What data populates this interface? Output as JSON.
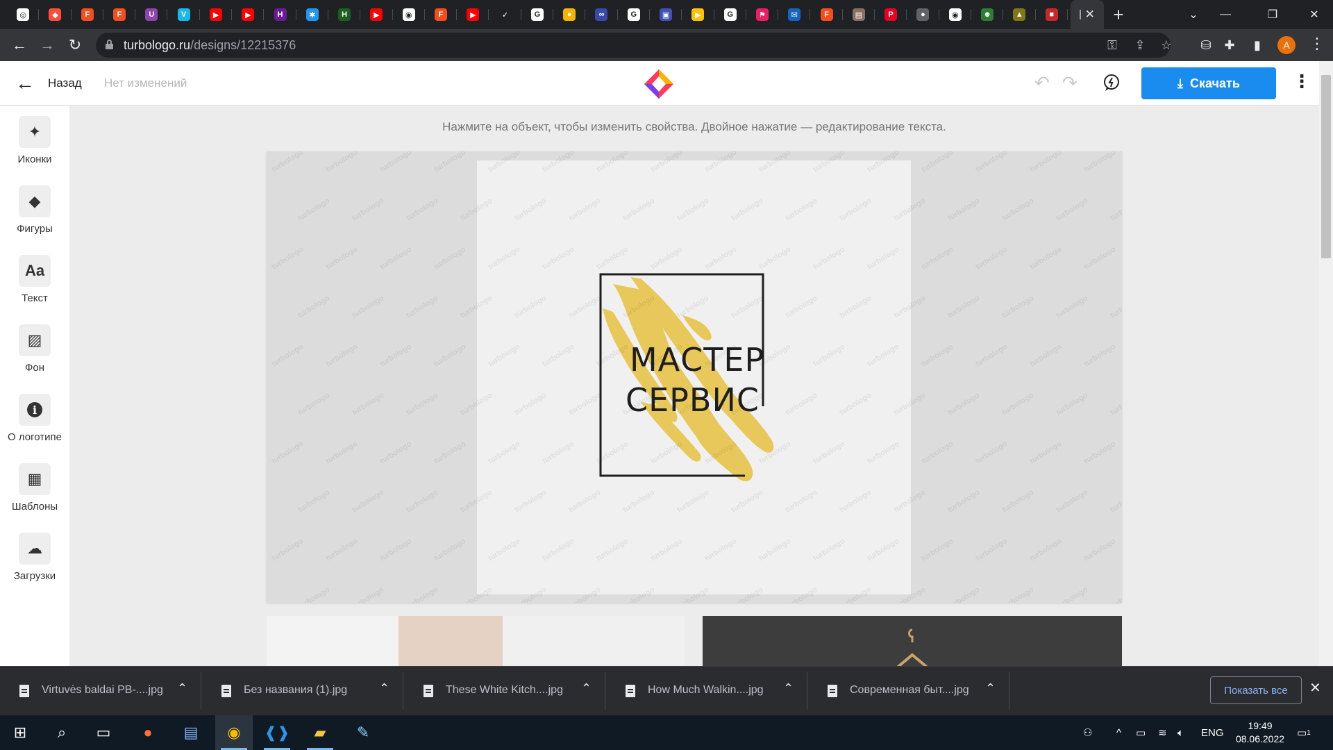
{
  "browser": {
    "tab_favicons": [
      {
        "icon": "chatgpt-like-icon",
        "color": "#ffffff",
        "glyph": "◎"
      },
      {
        "icon": "turbologo-icon",
        "color": "#ff4d3d",
        "glyph": "◆"
      },
      {
        "icon": "figma-icon",
        "color": "#f24e1e",
        "glyph": "F"
      },
      {
        "icon": "figma-icon",
        "color": "#f24e1e",
        "glyph": "F"
      },
      {
        "icon": "u-icon",
        "color": "#8e44ad",
        "glyph": "U"
      },
      {
        "icon": "vimeo-icon",
        "color": "#1ab7ea",
        "glyph": "V"
      },
      {
        "icon": "youtube-icon",
        "color": "#ff0000",
        "glyph": "▶"
      },
      {
        "icon": "youtube-icon",
        "color": "#ff0000",
        "glyph": "▶"
      },
      {
        "icon": "h-icon",
        "color": "#6a1b9a",
        "glyph": "H"
      },
      {
        "icon": "snowflake-icon",
        "color": "#2196f3",
        "glyph": "✱"
      },
      {
        "icon": "h-icon",
        "color": "#1b5e20",
        "glyph": "H"
      },
      {
        "icon": "youtube-icon",
        "color": "#ff0000",
        "glyph": "▶"
      },
      {
        "icon": "globe-icon",
        "color": "#ffffff",
        "glyph": "◉"
      },
      {
        "icon": "figma-icon",
        "color": "#f24e1e",
        "glyph": "F"
      },
      {
        "icon": "youtube-icon",
        "color": "#ff0000",
        "glyph": "▶"
      },
      {
        "icon": "nike-icon",
        "color": "#202124",
        "glyph": "✓"
      },
      {
        "icon": "google-icon",
        "color": "#ffffff",
        "glyph": "G"
      },
      {
        "icon": "circle-icon",
        "color": "#f4b400",
        "glyph": "●"
      },
      {
        "icon": "link-icon",
        "color": "#3949ab",
        "glyph": "∞"
      },
      {
        "icon": "google-icon",
        "color": "#ffffff",
        "glyph": "G"
      },
      {
        "icon": "app-icon",
        "color": "#3f51b5",
        "glyph": "▣"
      },
      {
        "icon": "play-icon",
        "color": "#ffc107",
        "glyph": "▶"
      },
      {
        "icon": "google-icon",
        "color": "#ffffff",
        "glyph": "G"
      },
      {
        "icon": "flag-icon",
        "color": "#e91e63",
        "glyph": "⚑"
      },
      {
        "icon": "mail-icon",
        "color": "#1565c0",
        "glyph": "✉"
      },
      {
        "icon": "figma-icon",
        "color": "#f24e1e",
        "glyph": "F"
      },
      {
        "icon": "book-icon",
        "color": "#8d6e63",
        "glyph": "▤"
      },
      {
        "icon": "pinterest-icon",
        "color": "#e60023",
        "glyph": "P"
      },
      {
        "icon": "drop-icon",
        "color": "#5f6368",
        "glyph": "●"
      },
      {
        "icon": "globe-icon",
        "color": "#ffffff",
        "glyph": "◉"
      },
      {
        "icon": "frog-icon",
        "color": "#2e7d32",
        "glyph": "☻"
      },
      {
        "icon": "tree-icon",
        "color": "#827717",
        "glyph": "▲"
      },
      {
        "icon": "stop-icon",
        "color": "#c62828",
        "glyph": "■"
      }
    ],
    "url_host": "turbologo.ru",
    "url_path": "/designs/12215376",
    "profile_initial": "A"
  },
  "app": {
    "back_label": "Назад",
    "save_status": "Нет изменений",
    "download_label": "Скачать",
    "accent": "#1a8cf0",
    "sidebar": [
      {
        "label": "Иконки",
        "icon": "sparkle-icon",
        "glyph": "✦"
      },
      {
        "label": "Фигуры",
        "icon": "shapes-icon",
        "glyph": "◆"
      },
      {
        "label": "Текст",
        "icon": "text-icon",
        "glyph": "Aa"
      },
      {
        "label": "Фон",
        "icon": "background-icon",
        "glyph": "▨"
      },
      {
        "label": "О логотипе",
        "icon": "info-icon",
        "glyph": "i"
      },
      {
        "label": "Шаблоны",
        "icon": "templates-icon",
        "glyph": "▦"
      },
      {
        "label": "Загрузки",
        "icon": "upload-icon",
        "glyph": "☁"
      }
    ],
    "hint": "Нажмите на объект, чтобы изменить свойства. Двойное нажатие — редактирование текста.",
    "logo": {
      "line1": "МАСТЕР",
      "line2": "СЕРВИС",
      "accent_color": "#e8c85a",
      "frame_color": "#1e1e1e"
    },
    "watermark_text": "turbologo"
  },
  "downloads": {
    "items": [
      "Virtuvės baldai PB-....jpg",
      "Без названия (1).jpg",
      "These White Kitch....jpg",
      "How Much Walkin....jpg",
      "Современная быт....jpg"
    ],
    "show_all": "Показать все"
  },
  "taskbar": {
    "lang": "ENG",
    "time": "19:49",
    "date": "08.06.2022",
    "notifications": "1"
  }
}
